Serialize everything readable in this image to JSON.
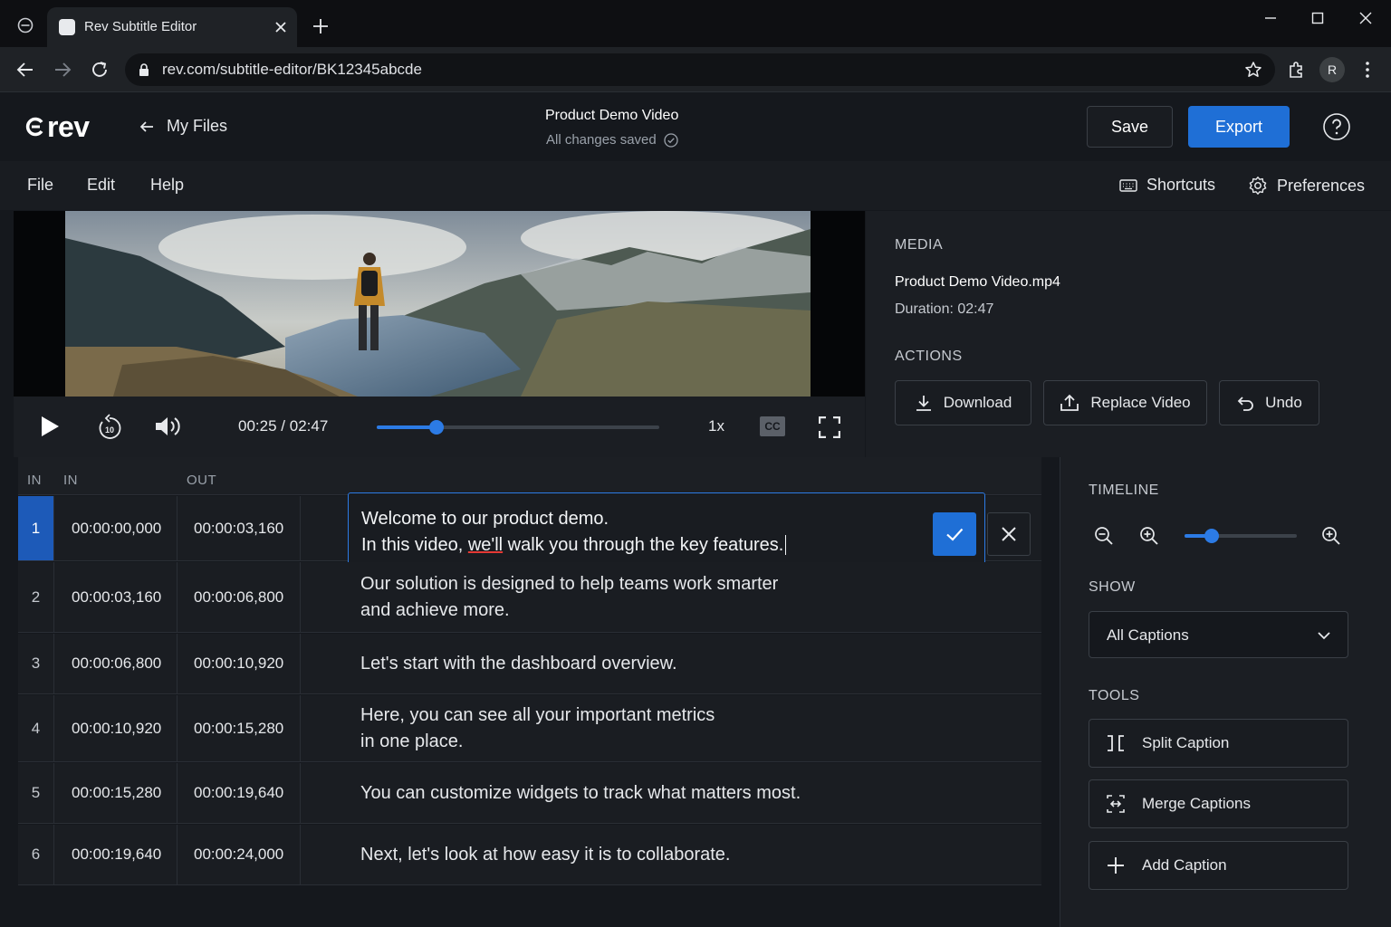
{
  "browser": {
    "tab_title": "Rev Subtitle Editor",
    "url": "rev.com/subtitle-editor/BK12345abcde",
    "profile_initial": "R"
  },
  "header": {
    "logo_text": "rev",
    "back_label": "My Files",
    "doc_title": "Product Demo Video",
    "save_status": "All changes saved",
    "save_label": "Save",
    "export_label": "Export",
    "accent_color": "#1f6fd6"
  },
  "menu": {
    "file": "File",
    "edit": "Edit",
    "help": "Help",
    "shortcuts": "Shortcuts",
    "preferences": "Preferences"
  },
  "player": {
    "current_time": "00:25",
    "separator": "/",
    "duration": "02:47",
    "progress": 0.21,
    "speed": "1x",
    "cc_label": "CC",
    "skip_seconds": "10"
  },
  "media": {
    "section_label": "MEDIA",
    "file_name": "Product Demo Video.mp4",
    "duration_label": "Duration: 02:47",
    "actions_label": "ACTIONS",
    "download": "Download",
    "replace": "Replace Video",
    "undo": "Undo"
  },
  "table": {
    "col_idx": "IN",
    "col_in": "IN",
    "col_out": "OUT"
  },
  "captions": [
    {
      "idx": "1",
      "in": "00:00:00,000",
      "out": "00:00:03,160",
      "line1": "Welcome to our product demo.",
      "line2_before": "In this video, ",
      "line2_flag": "we'll",
      "line2_after": " walk you through the key features."
    },
    {
      "idx": "2",
      "in": "00:00:03,160",
      "out": "00:00:06,800",
      "line1": "Our solution is designed to help teams work smarter",
      "line2": "and achieve more."
    },
    {
      "idx": "3",
      "in": "00:00:06,800",
      "out": "00:00:10,920",
      "line1": "Let's start with the dashboard overview.",
      "line2": ""
    },
    {
      "idx": "4",
      "in": "00:00:10,920",
      "out": "00:00:15,280",
      "line1": "Here, you can see all your important metrics",
      "line2": "in one place."
    },
    {
      "idx": "5",
      "in": "00:00:15,280",
      "out": "00:00:19,640",
      "line1": "You can customize widgets to track what matters most.",
      "line2": ""
    },
    {
      "idx": "6",
      "in": "00:00:19,640",
      "out": "00:00:24,000",
      "line1": "Next, let's look at how easy it is to collaborate.",
      "line2": ""
    }
  ],
  "sidebar": {
    "timeline_label": "TIMELINE",
    "zoom_level": 0.24,
    "show_label": "SHOW",
    "show_value": "All Captions",
    "tools_label": "TOOLS",
    "split": "Split Caption",
    "merge": "Merge Captions",
    "add": "Add Caption"
  }
}
